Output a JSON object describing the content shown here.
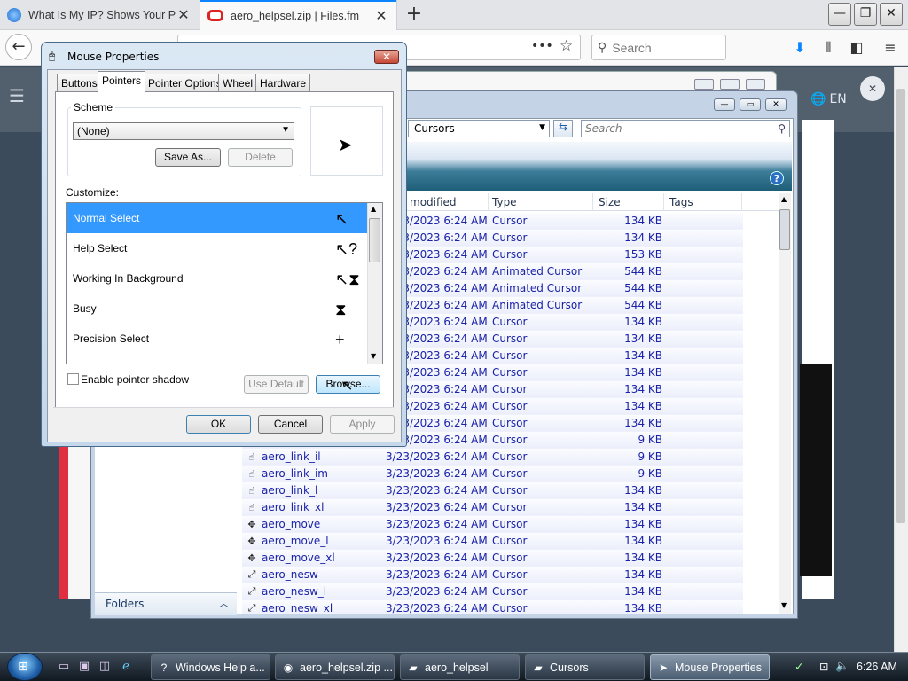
{
  "browser": {
    "tabs": [
      {
        "title": "What Is My IP? Shows Your Pu",
        "active": false
      },
      {
        "title": "aero_helpsel.zip | Files.fm",
        "active": true
      }
    ],
    "search_placeholder": "Search",
    "page_lang": "EN"
  },
  "explorer": {
    "address": "Cursors",
    "search_placeholder": "Search",
    "columns": [
      "modified",
      "Type",
      "Size",
      "Tags"
    ],
    "folders_label": "Folders",
    "rows": [
      {
        "name": "",
        "modified": "3/23/2023 6:24 AM",
        "type": "Cursor",
        "size": "134 KB"
      },
      {
        "name": "",
        "modified": "3/23/2023 6:24 AM",
        "type": "Cursor",
        "size": "134 KB"
      },
      {
        "name": "",
        "modified": "3/23/2023 6:24 AM",
        "type": "Cursor",
        "size": "153 KB"
      },
      {
        "name": "",
        "modified": "3/23/2023 6:24 AM",
        "type": "Animated Cursor",
        "size": "544 KB"
      },
      {
        "name": "",
        "modified": "3/23/2023 6:24 AM",
        "type": "Animated Cursor",
        "size": "544 KB"
      },
      {
        "name": "",
        "modified": "3/23/2023 6:24 AM",
        "type": "Animated Cursor",
        "size": "544 KB"
      },
      {
        "name": "",
        "modified": "3/23/2023 6:24 AM",
        "type": "Cursor",
        "size": "134 KB"
      },
      {
        "name": "",
        "modified": "3/23/2023 6:24 AM",
        "type": "Cursor",
        "size": "134 KB"
      },
      {
        "name": "",
        "modified": "3/23/2023 6:24 AM",
        "type": "Cursor",
        "size": "134 KB"
      },
      {
        "name": "",
        "modified": "3/23/2023 6:24 AM",
        "type": "Cursor",
        "size": "134 KB"
      },
      {
        "name": "",
        "modified": "3/23/2023 6:24 AM",
        "type": "Cursor",
        "size": "134 KB"
      },
      {
        "name": "",
        "modified": "3/23/2023 6:24 AM",
        "type": "Cursor",
        "size": "134 KB"
      },
      {
        "name": "",
        "modified": "3/23/2023 6:24 AM",
        "type": "Cursor",
        "size": "134 KB"
      },
      {
        "name": "",
        "modified": "3/23/2023 6:24 AM",
        "type": "Cursor",
        "size": "9 KB"
      },
      {
        "name": "aero_link_il",
        "modified": "3/23/2023 6:24 AM",
        "type": "Cursor",
        "size": "9 KB"
      },
      {
        "name": "aero_link_im",
        "modified": "3/23/2023 6:24 AM",
        "type": "Cursor",
        "size": "9 KB"
      },
      {
        "name": "aero_link_l",
        "modified": "3/23/2023 6:24 AM",
        "type": "Cursor",
        "size": "134 KB"
      },
      {
        "name": "aero_link_xl",
        "modified": "3/23/2023 6:24 AM",
        "type": "Cursor",
        "size": "134 KB"
      },
      {
        "name": "aero_move",
        "modified": "3/23/2023 6:24 AM",
        "type": "Cursor",
        "size": "134 KB"
      },
      {
        "name": "aero_move_l",
        "modified": "3/23/2023 6:24 AM",
        "type": "Cursor",
        "size": "134 KB"
      },
      {
        "name": "aero_move_xl",
        "modified": "3/23/2023 6:24 AM",
        "type": "Cursor",
        "size": "134 KB"
      },
      {
        "name": "aero_nesw",
        "modified": "3/23/2023 6:24 AM",
        "type": "Cursor",
        "size": "134 KB"
      },
      {
        "name": "aero_nesw_l",
        "modified": "3/23/2023 6:24 AM",
        "type": "Cursor",
        "size": "134 KB"
      },
      {
        "name": "aero_nesw_xl",
        "modified": "3/23/2023 6:24 AM",
        "type": "Cursor",
        "size": "134 KB"
      }
    ]
  },
  "dialog": {
    "title": "Mouse Properties",
    "tabs": [
      "Buttons",
      "Pointers",
      "Pointer Options",
      "Wheel",
      "Hardware"
    ],
    "scheme_label": "Scheme",
    "scheme_value": "(None)",
    "save_as": "Save As...",
    "delete": "Delete",
    "customize_label": "Customize:",
    "cursors": [
      {
        "label": "Normal Select",
        "selected": true
      },
      {
        "label": "Help Select",
        "selected": false
      },
      {
        "label": "Working In Background",
        "selected": false
      },
      {
        "label": "Busy",
        "selected": false
      },
      {
        "label": "Precision Select",
        "selected": false
      }
    ],
    "shadow_label": "Enable pointer shadow",
    "use_default": "Use Default",
    "browse": "Browse...",
    "ok": "OK",
    "cancel": "Cancel",
    "apply": "Apply"
  },
  "taskbar": {
    "items": [
      {
        "label": "Windows Help a..."
      },
      {
        "label": "aero_helpsel.zip ..."
      },
      {
        "label": "aero_helpsel"
      },
      {
        "label": "Cursors"
      },
      {
        "label": "Mouse Properties"
      }
    ],
    "clock": "6:26 AM"
  }
}
